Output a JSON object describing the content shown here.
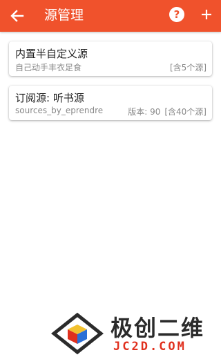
{
  "header": {
    "title": "源管理",
    "back_icon": "arrow-left-icon",
    "help_icon": "help-icon",
    "help_glyph": "?",
    "add_icon": "plus-icon",
    "bg_color": "#f0522c"
  },
  "sources": [
    {
      "name": "内置半自定义源",
      "subtitle": "自己动手丰衣足食",
      "version": "",
      "count": "[含5个源]"
    },
    {
      "name": "订阅源: 听书源",
      "subtitle": "sources_by_eprendre",
      "version": "版本: 90",
      "count": "[含40个源]"
    }
  ],
  "watermark": {
    "cn_text": "极创二维",
    "en_text": "JC2D.COM",
    "accent_color": "#e0301e"
  }
}
